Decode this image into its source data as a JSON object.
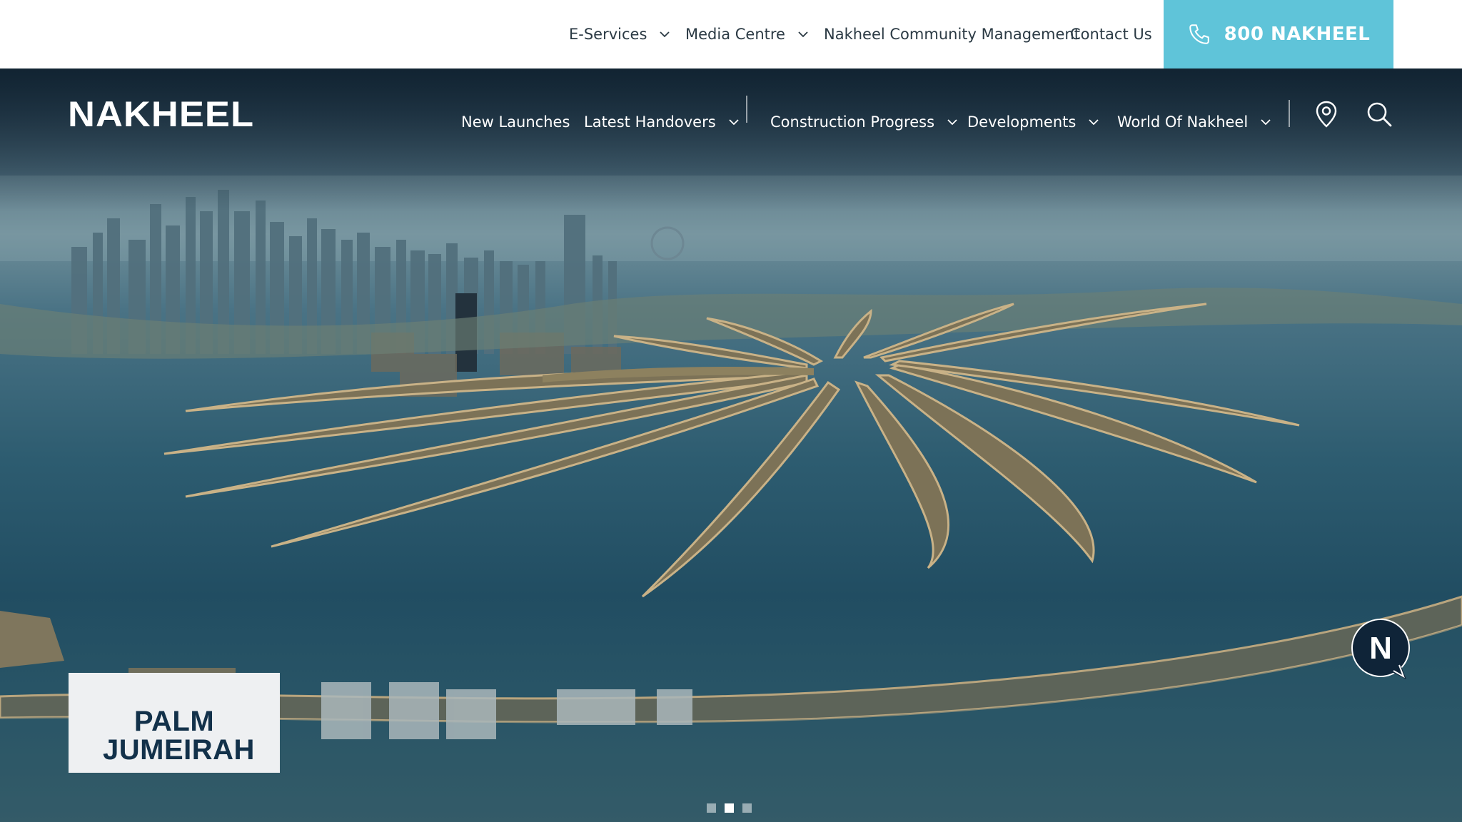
{
  "topbar": {
    "items": [
      {
        "label": "E-Services",
        "has_dropdown": true
      },
      {
        "label": "Media Centre",
        "has_dropdown": true
      },
      {
        "label": "Nakheel Community Management",
        "has_dropdown": false
      },
      {
        "label": "Contact Us",
        "has_dropdown": false
      }
    ],
    "phone": {
      "label": "800 NAKHEEL",
      "icon": "phone-icon",
      "background": "#5fc4d9"
    }
  },
  "header": {
    "logo_text": "NAKHEEL",
    "nav": [
      {
        "label": "New Launches",
        "has_dropdown": false
      },
      {
        "label": "Latest Handovers",
        "has_dropdown": true
      },
      {
        "label": "Construction Progress",
        "has_dropdown": true
      },
      {
        "label": "Developments",
        "has_dropdown": true
      },
      {
        "label": "World Of Nakheel",
        "has_dropdown": true
      }
    ],
    "icons": [
      "map-pin-icon",
      "search-icon"
    ]
  },
  "hero": {
    "image": "aerial view of palm-shaped island with city skyline",
    "card_title": "PALM JUMEIRAH",
    "slides": {
      "count": 3,
      "active_index": 1
    },
    "chat_badge_letter": "N"
  },
  "colors": {
    "accent": "#5fc4d9",
    "navy": "#12314a",
    "white": "#ffffff"
  }
}
